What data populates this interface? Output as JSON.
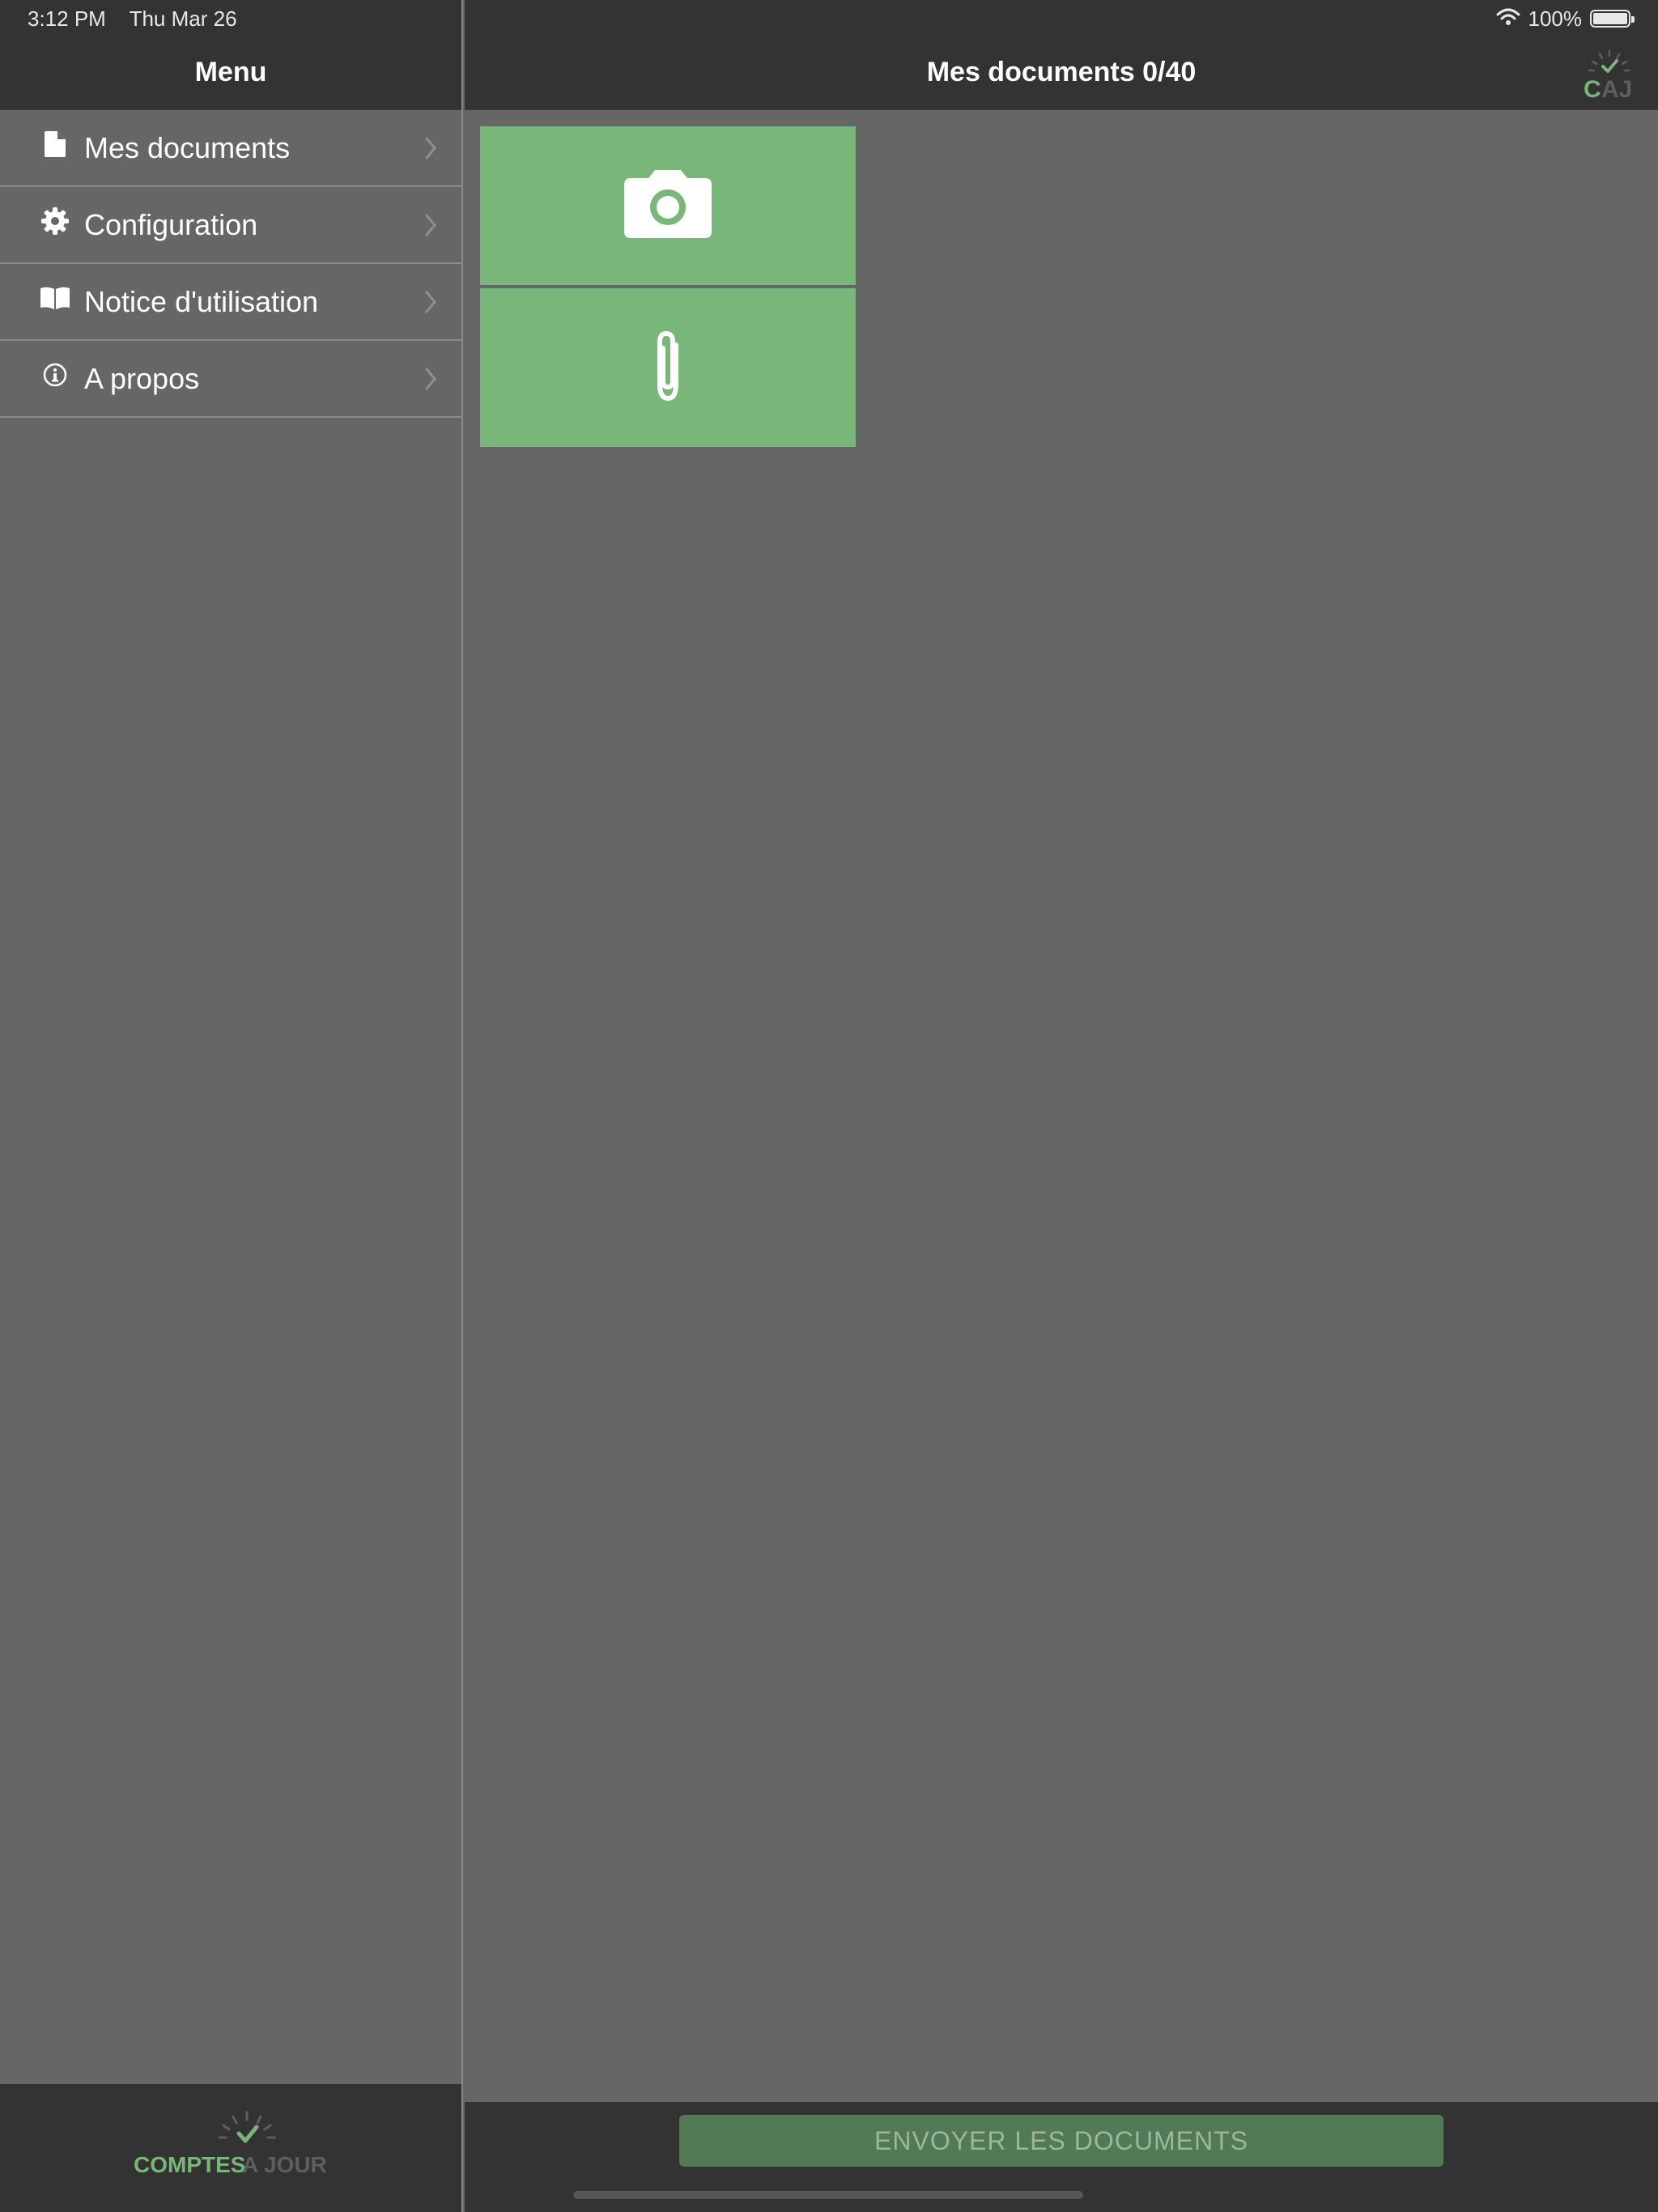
{
  "status_bar": {
    "time": "3:12 PM",
    "date": "Thu Mar 26",
    "battery": "100%",
    "wifi_icon": "wifi-icon",
    "battery_icon": "battery-icon",
    "battery_level": 1.0
  },
  "sidebar": {
    "title": "Menu",
    "items": [
      {
        "label": "Mes documents",
        "icon": "document-icon"
      },
      {
        "label": "Configuration",
        "icon": "gear-icon"
      },
      {
        "label": "Notice d'utilisation",
        "icon": "book-icon"
      },
      {
        "label": "A propos",
        "icon": "info-icon"
      }
    ],
    "footer_logo": {
      "word1": "COMPTES",
      "word2": "A JOUR"
    }
  },
  "main": {
    "title": "Mes documents 0/40",
    "header_logo": "CAJ",
    "tiles": [
      {
        "icon": "camera-icon"
      },
      {
        "icon": "paperclip-icon"
      }
    ],
    "send_button_label": "ENVOYER LES DOCUMENTS"
  },
  "colors": {
    "accent_green": "#78b67a",
    "bar_dark": "#333333",
    "background": "#666666",
    "button_disabled": "#527a55"
  }
}
